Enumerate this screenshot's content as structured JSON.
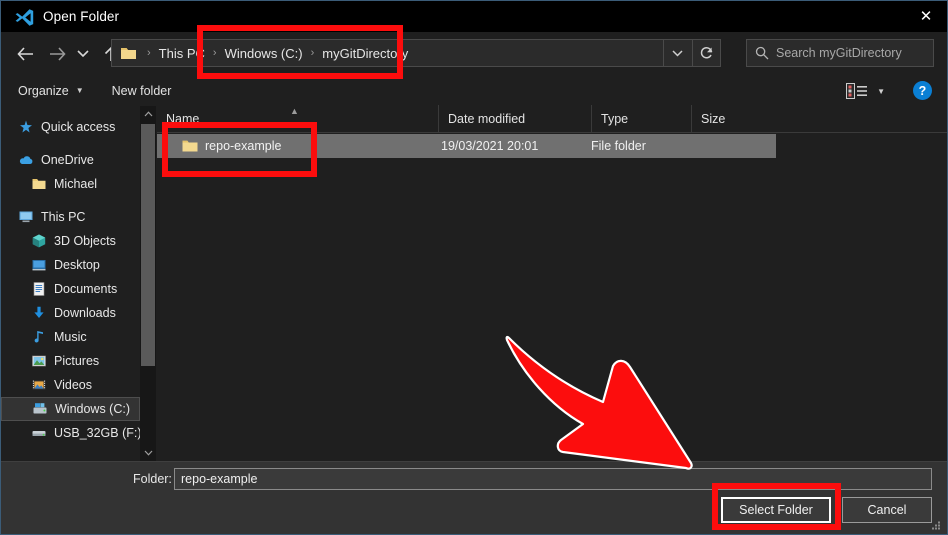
{
  "window": {
    "title": "Open Folder",
    "title_icon": "vscode-logo-icon",
    "close_icon": "✕"
  },
  "navigation": {
    "back_icon": "←",
    "forward_icon": "→",
    "recent_icon": "⌄",
    "up_icon": "↑",
    "breadcrumbs": [
      {
        "label": "This PC"
      },
      {
        "label": "Windows (C:)"
      },
      {
        "label": "myGitDirectory"
      }
    ],
    "separator": "›",
    "dropdown_icon": "⌄",
    "refresh_icon": "↻"
  },
  "search": {
    "placeholder": "Search myGitDirectory",
    "value": "",
    "icon": "search-icon"
  },
  "toolbar": {
    "organize_label": "Organize",
    "organize_caret": "▼",
    "new_folder_label": "New folder",
    "view_icon": "list-view-icon",
    "view_caret": "▼",
    "help_label": "?"
  },
  "sidebar": {
    "items": [
      {
        "label": "Quick access",
        "icon": "star-icon",
        "level": 0,
        "selected": false
      },
      {
        "label": "OneDrive",
        "icon": "cloud-icon",
        "level": 0,
        "selected": false
      },
      {
        "label": "Michael",
        "icon": "folder-icon",
        "level": 1,
        "selected": false
      },
      {
        "label": "This PC",
        "icon": "monitor-icon",
        "level": 0,
        "selected": false
      },
      {
        "label": "3D Objects",
        "icon": "cube-icon",
        "level": 1,
        "selected": false
      },
      {
        "label": "Desktop",
        "icon": "desktop-icon",
        "level": 1,
        "selected": false
      },
      {
        "label": "Documents",
        "icon": "document-icon",
        "level": 1,
        "selected": false
      },
      {
        "label": "Downloads",
        "icon": "download-arrow-icon",
        "level": 1,
        "selected": false
      },
      {
        "label": "Music",
        "icon": "music-note-icon",
        "level": 1,
        "selected": false
      },
      {
        "label": "Pictures",
        "icon": "picture-icon",
        "level": 1,
        "selected": false
      },
      {
        "label": "Videos",
        "icon": "video-film-icon",
        "level": 1,
        "selected": false
      },
      {
        "label": "Windows (C:)",
        "icon": "hard-drive-icon",
        "level": 1,
        "selected": true
      },
      {
        "label": "USB_32GB (F:)",
        "icon": "usb-drive-icon",
        "level": 1,
        "selected": false
      }
    ],
    "scroll_up_icon": "▲",
    "scroll_down_icon": "▼"
  },
  "file_list": {
    "columns": [
      {
        "label": "Name"
      },
      {
        "label": "Date modified"
      },
      {
        "label": "Type"
      },
      {
        "label": "Size"
      }
    ],
    "sort_caret": "▲",
    "rows": [
      {
        "name": "repo-example",
        "date_modified": "19/03/2021 20:01",
        "type": "File folder",
        "size": "",
        "icon": "folder-icon",
        "selected": true
      }
    ]
  },
  "footer": {
    "folder_label": "Folder:",
    "folder_value": "repo-example",
    "select_button": "Select Folder",
    "cancel_button": "Cancel",
    "resize_grip_icon": "resize-grip-icon"
  },
  "annotations": {
    "color": "#fc0d0d",
    "outline_color": "#ffffff",
    "highlight_breadcrumb": "Windows (C:) › myGitDirectory",
    "highlight_row": "repo-example",
    "highlight_button": "Select Folder",
    "arrow_icon": "red-arrow-pointing-down-right-icon"
  },
  "colors": {
    "window_bg": "#1f1f1f",
    "titlebar_bg": "#000000",
    "footer_bg": "#333333",
    "selection_bg": "#707070",
    "accent_blue": "#0a7fd4",
    "annotation_red": "#fc0d0d"
  }
}
